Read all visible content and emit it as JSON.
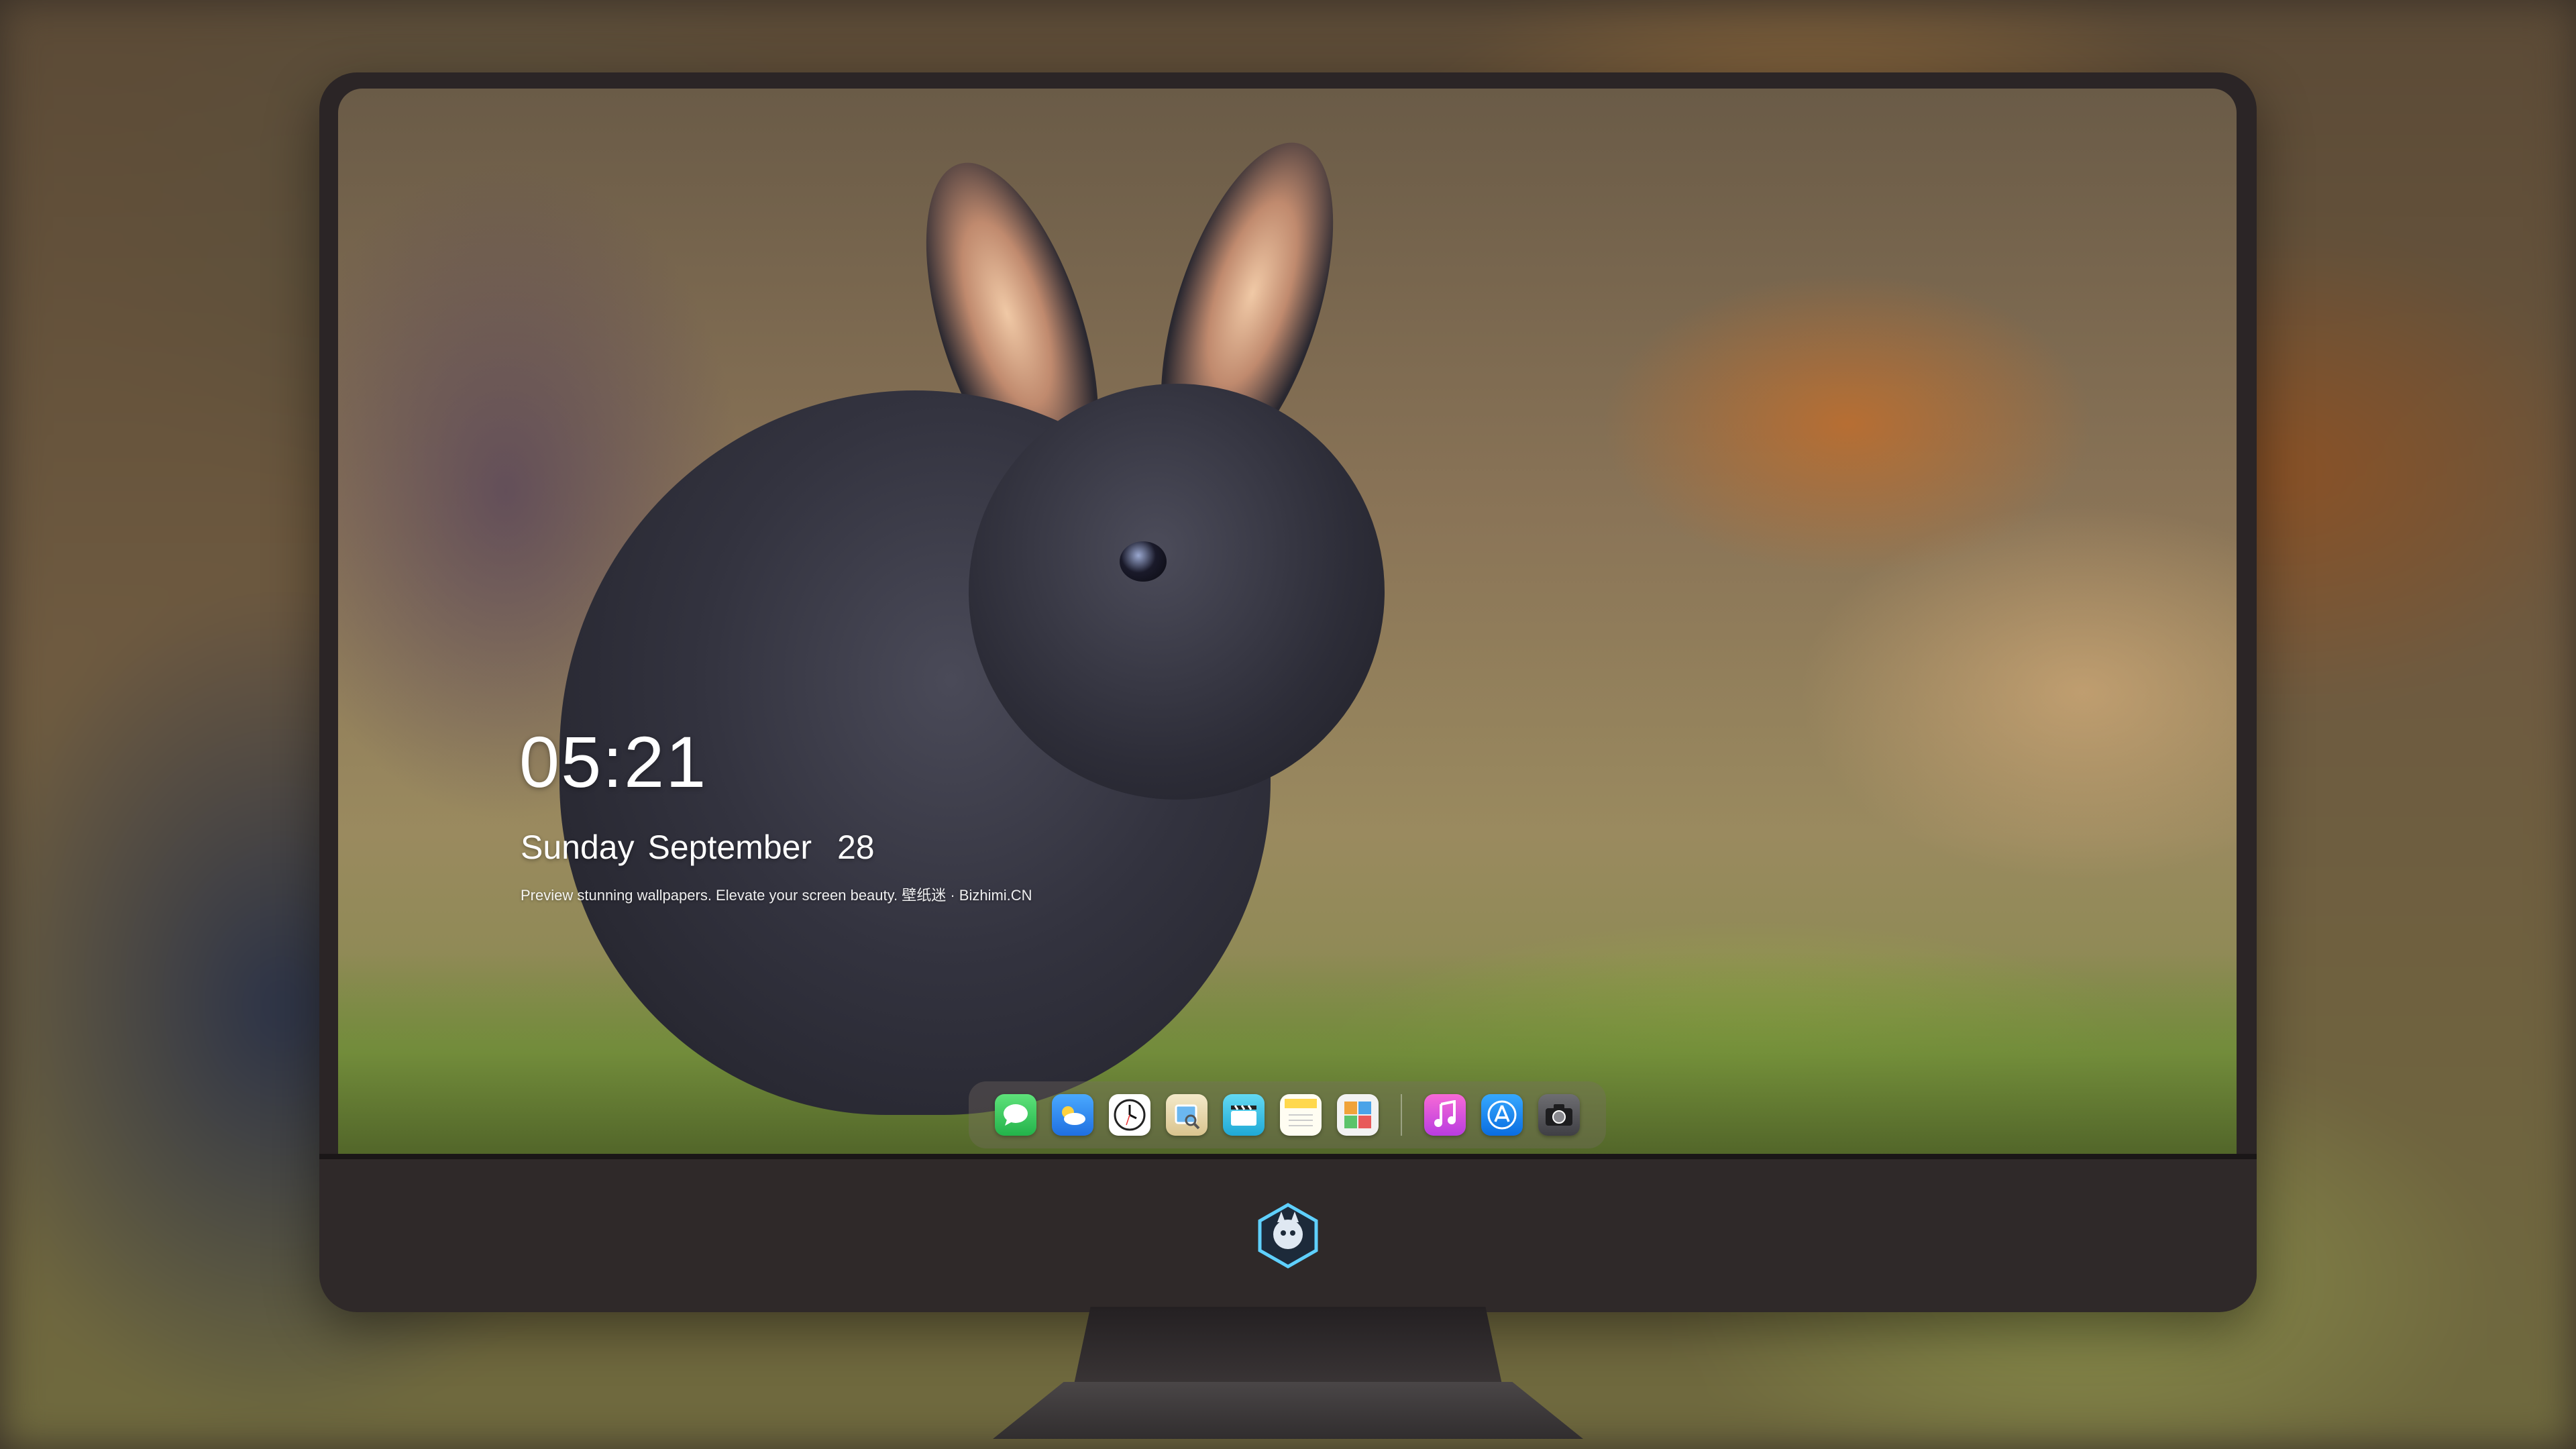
{
  "lock_screen": {
    "time": "05:21",
    "weekday": "Sunday",
    "month": "September",
    "day": "28",
    "tagline": "Preview stunning wallpapers. Elevate your screen beauty. 壁纸迷 · Bizhimi.CN"
  },
  "dock": {
    "apps": [
      {
        "name": "Messages",
        "icon": "messages-icon",
        "color": "#34c759"
      },
      {
        "name": "Weather",
        "icon": "weather-icon",
        "color": "#2f8cf2"
      },
      {
        "name": "Clock",
        "icon": "clock-icon",
        "color": "#ffffff"
      },
      {
        "name": "Preview",
        "icon": "preview-icon",
        "color": "#e9c46a"
      },
      {
        "name": "Clips",
        "icon": "clips-icon",
        "color": "#38c6e8"
      },
      {
        "name": "Notes",
        "icon": "notes-icon",
        "color": "#ffd84d"
      },
      {
        "name": "Photo Booth",
        "icon": "photo-booth-icon",
        "color": "#4aa3e8"
      },
      {
        "name": "Music",
        "icon": "music-icon",
        "color": "#e855c8"
      },
      {
        "name": "App Store",
        "icon": "app-store-icon",
        "color": "#1e8af0"
      },
      {
        "name": "Camera",
        "icon": "camera-icon",
        "color": "#5a5a5e"
      }
    ]
  },
  "colors": {
    "monitor_bezel": "#2b2526",
    "text": "#ffffff"
  }
}
